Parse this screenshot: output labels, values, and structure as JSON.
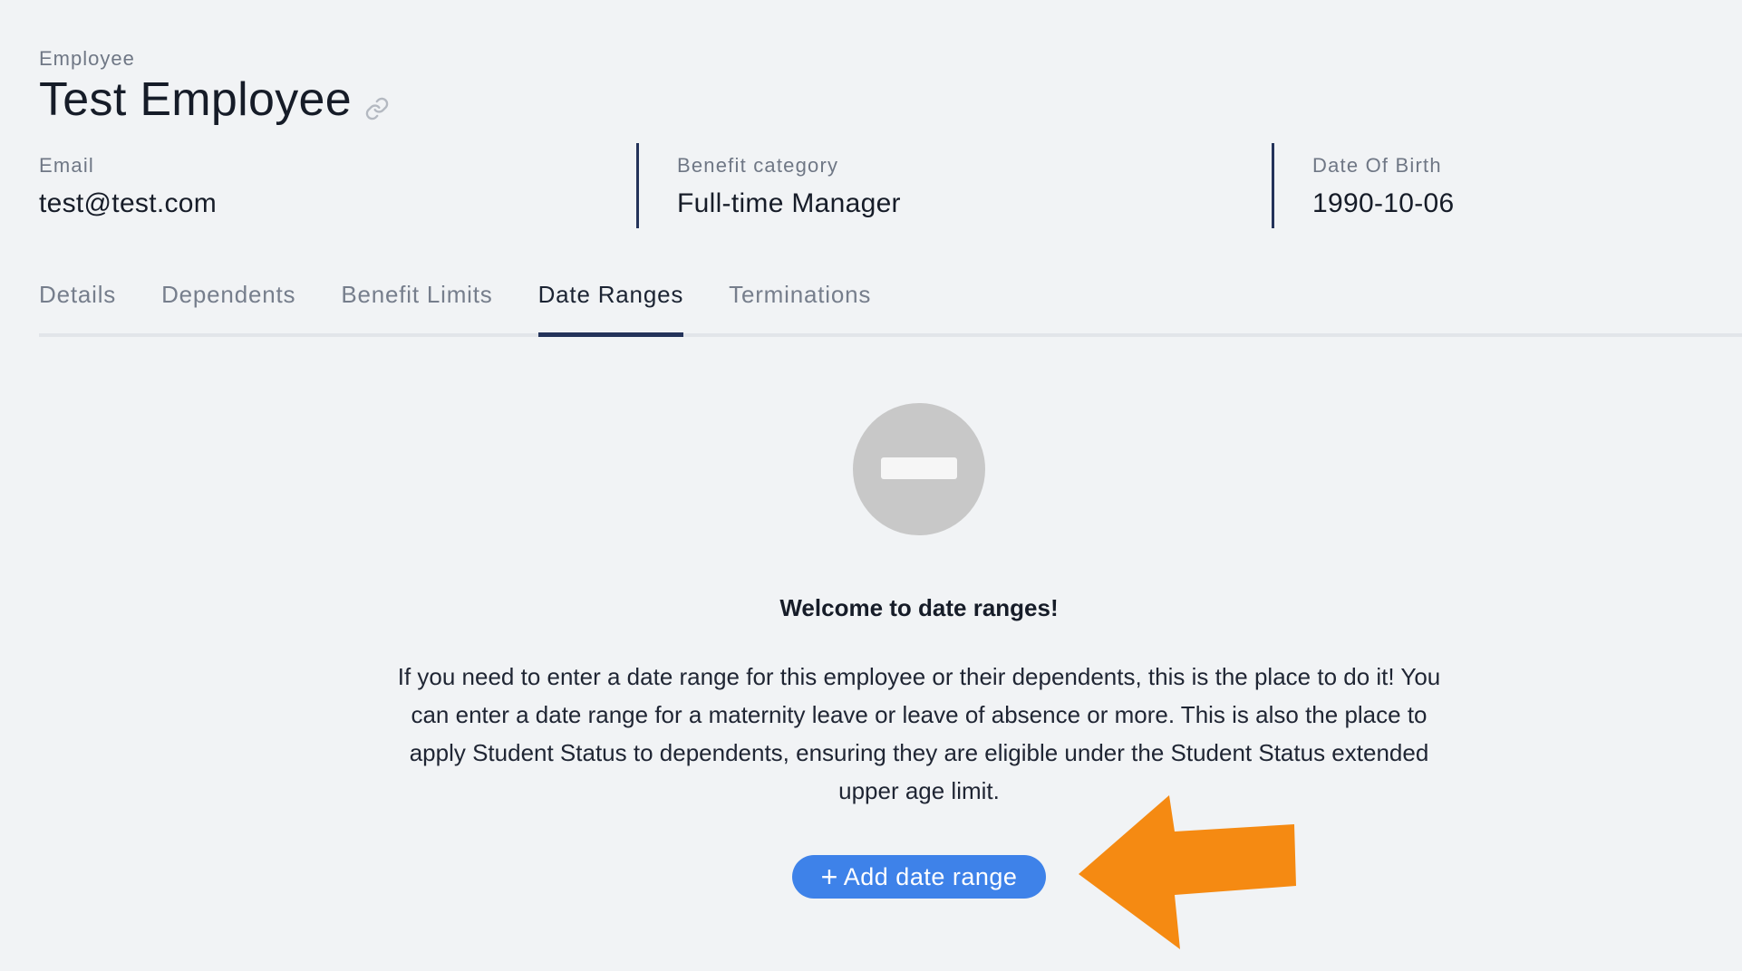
{
  "header": {
    "eyebrow": "Employee",
    "title": "Test Employee"
  },
  "meta": {
    "email_label": "Email",
    "email_value": "test@test.com",
    "benefit_label": "Benefit category",
    "benefit_value": "Full-time Manager",
    "dob_label": "Date Of Birth",
    "dob_value": "1990-10-06"
  },
  "tabs": [
    {
      "label": "Details",
      "active": false
    },
    {
      "label": "Dependents",
      "active": false
    },
    {
      "label": "Benefit Limits",
      "active": false
    },
    {
      "label": "Date Ranges",
      "active": true
    },
    {
      "label": "Terminations",
      "active": false
    }
  ],
  "empty_state": {
    "icon": "minus-circle-icon",
    "heading": "Welcome to date ranges!",
    "description": "If you need to enter a date range for this employee or their dependents, this is the place to do it! You can enter a date range for a maternity leave or leave of absence or more. This is also the place to apply Student Status to dependents, ensuring they are eligible under the Student Status extended upper age limit.",
    "button_label": "Add date range",
    "button_icon": "plus-icon"
  },
  "colors": {
    "background": "#f1f3f5",
    "accent_button": "#3e82e9",
    "active_tab_underline": "#24335a",
    "annotation_arrow": "#f58a12"
  }
}
